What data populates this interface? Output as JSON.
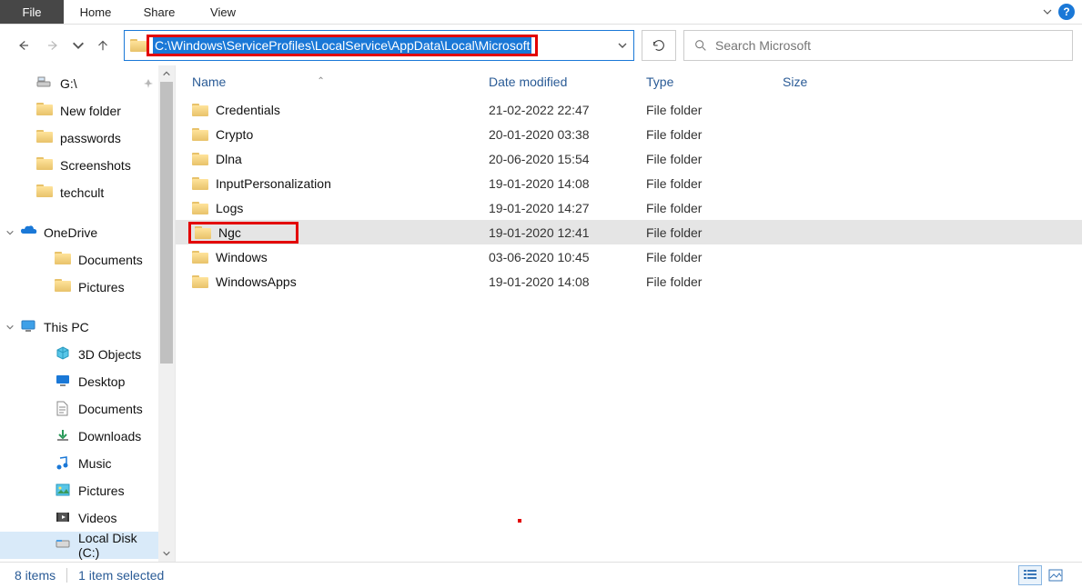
{
  "ribbon": {
    "file": "File",
    "tabs": [
      "Home",
      "Share",
      "View"
    ]
  },
  "nav": {
    "address_path": "C:\\Windows\\ServiceProfiles\\LocalService\\AppData\\Local\\Microsoft",
    "search_placeholder": "Search Microsoft"
  },
  "sidebar": {
    "items": [
      {
        "label": "G:\\",
        "icon": "drive",
        "pinned": true
      },
      {
        "label": "New folder",
        "icon": "folder"
      },
      {
        "label": "passwords",
        "icon": "folder"
      },
      {
        "label": "Screenshots",
        "icon": "folder"
      },
      {
        "label": "techcult",
        "icon": "folder"
      }
    ],
    "onedrive": {
      "label": "OneDrive",
      "children": [
        {
          "label": "Documents",
          "icon": "folder"
        },
        {
          "label": "Pictures",
          "icon": "folder"
        }
      ]
    },
    "thispc": {
      "label": "This PC",
      "children": [
        {
          "label": "3D Objects",
          "icon": "3d"
        },
        {
          "label": "Desktop",
          "icon": "desktop"
        },
        {
          "label": "Documents",
          "icon": "documents"
        },
        {
          "label": "Downloads",
          "icon": "downloads"
        },
        {
          "label": "Music",
          "icon": "music"
        },
        {
          "label": "Pictures",
          "icon": "pictures"
        },
        {
          "label": "Videos",
          "icon": "videos"
        },
        {
          "label": "Local Disk (C:)",
          "icon": "disk",
          "selected": true
        }
      ]
    }
  },
  "columns": {
    "name": "Name",
    "date": "Date modified",
    "type": "Type",
    "size": "Size"
  },
  "rows": [
    {
      "name": "Credentials",
      "date": "21-02-2022 22:47",
      "type": "File folder"
    },
    {
      "name": "Crypto",
      "date": "20-01-2020 03:38",
      "type": "File folder"
    },
    {
      "name": "Dlna",
      "date": "20-06-2020 15:54",
      "type": "File folder"
    },
    {
      "name": "InputPersonalization",
      "date": "19-01-2020 14:08",
      "type": "File folder"
    },
    {
      "name": "Logs",
      "date": "19-01-2020 14:27",
      "type": "File folder"
    },
    {
      "name": "Ngc",
      "date": "19-01-2020 12:41",
      "type": "File folder",
      "selected": true,
      "boxed": true
    },
    {
      "name": "Windows",
      "date": "03-06-2020 10:45",
      "type": "File folder"
    },
    {
      "name": "WindowsApps",
      "date": "19-01-2020 14:08",
      "type": "File folder"
    }
  ],
  "status": {
    "count": "8 items",
    "selected": "1 item selected"
  }
}
